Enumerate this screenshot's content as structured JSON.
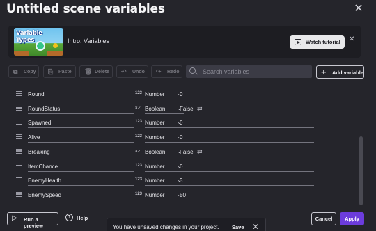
{
  "dialog": {
    "title": "Untitled scene variables",
    "close_icon": "close-icon"
  },
  "tutorial": {
    "thumbnail_text": "Variable Types",
    "label": "Intro: Variables",
    "watch_label": "Watch tutorial"
  },
  "toolbar": {
    "copy_label": "Copy",
    "paste_label": "Paste",
    "delete_label": "Delete",
    "undo_label": "Undo",
    "redo_label": "Redo",
    "search_placeholder": "Search variables",
    "add_label": "Add variable"
  },
  "variables": [
    {
      "name": "Round",
      "type_icon": "123",
      "type": "Number",
      "value": "0",
      "bool": false
    },
    {
      "name": "RoundStatus",
      "type_icon": "×✓",
      "type": "Boolean",
      "value": "False",
      "bool": true
    },
    {
      "name": "Spawned",
      "type_icon": "123",
      "type": "Number",
      "value": "0",
      "bool": false
    },
    {
      "name": "Alive",
      "type_icon": "123",
      "type": "Number",
      "value": "0",
      "bool": false
    },
    {
      "name": "Breaking",
      "type_icon": "×✓",
      "type": "Boolean",
      "value": "False",
      "bool": true
    },
    {
      "name": "ItemChance",
      "type_icon": "123",
      "type": "Number",
      "value": "0",
      "bool": false
    },
    {
      "name": "EnemyHealth",
      "type_icon": "123",
      "type": "Number",
      "value": "3",
      "bool": false
    },
    {
      "name": "EnemySpeed",
      "type_icon": "123",
      "type": "Number",
      "value": "50",
      "bool": false
    }
  ],
  "footer": {
    "preview_label": "Run a preview",
    "help_label": "Help",
    "unsaved_message": "You have unsaved changes in your project.",
    "save_label": "Save",
    "cancel_label": "Cancel",
    "apply_label": "Apply"
  },
  "colors": {
    "background": "#25252b",
    "accent": "#6c3cdc"
  }
}
